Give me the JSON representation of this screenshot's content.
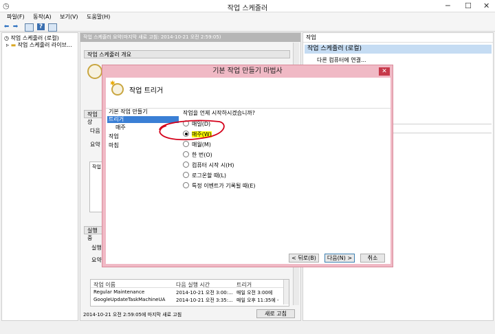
{
  "window": {
    "title": "작업 스케줄러"
  },
  "menu": [
    "파일(F)",
    "동작(A)",
    "보기(V)",
    "도움말(H)"
  ],
  "tree": {
    "root": "작업 스케줄러 (로컬)",
    "child": "작업 스케줄러 라이브..."
  },
  "center": {
    "header": "작업 스케줄러 요약(마지막 새로 고침: 2014-10-21 오전 2:59:05)",
    "overview": "작업 스케줄러 개요",
    "status_section": "작업 상",
    "next_label": "다음",
    "summary_label": "요약",
    "work_label": "작업",
    "active_section": "실행 중",
    "run_label": "실행",
    "summary2_label": "요약",
    "columns": [
      "작업 이름",
      "다음 실행 시간",
      "트리거"
    ],
    "rows": [
      [
        "Regular Maintenance",
        "2014-10-21 오전 3:00:...",
        "매일 오전 3:00에"
      ],
      [
        "GoogleUpdateTaskMachineUA",
        "2014-10-21 오전 3:35:...",
        "매일 오후 11:35에 -"
      ]
    ],
    "footer": "2014-10-21 오전 2:59:05에 마지막 새로 고침",
    "refresh_button": "새로 고침"
  },
  "right": {
    "header": "작업",
    "section": "작업 스케줄러 (로컬)",
    "item1": "다른 컴퓨터에 연결..."
  },
  "dialog": {
    "title": "기본 작업 만들기 마법사",
    "close": "✕",
    "heading": "작업 트리거",
    "nav": [
      "기본 작업 만들기",
      "트리거",
      "매주",
      "작업",
      "마침"
    ],
    "question": "작업을 언제 시작하시겠습니까?",
    "options": [
      "매일(D)",
      "매주(W)",
      "매월(M)",
      "한 번(O)",
      "컴퓨터 시작 시(H)",
      "로그온할 때(L)",
      "특정 이벤트가 기록될 때(E)"
    ],
    "selected_index": 1,
    "back_button": "< 뒤로(B)",
    "next_button": "다음(N) >",
    "cancel_button": "취소",
    "annotation_color": "#d4001a"
  }
}
